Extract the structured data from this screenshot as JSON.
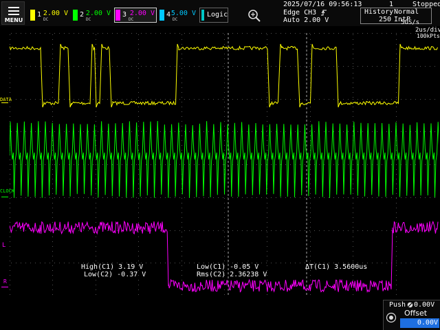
{
  "menu": {
    "label": "MENU"
  },
  "channels": [
    {
      "num": "1",
      "scale": "2.00 V",
      "color": "#ffff00",
      "coupling": "1M DC"
    },
    {
      "num": "2",
      "scale": "2.00 V",
      "color": "#00ff00",
      "coupling": "1M DC"
    },
    {
      "num": "3",
      "scale": "2.00 V",
      "color": "#ff00ff",
      "coupling": "1M DC",
      "selected": true
    },
    {
      "num": "4",
      "scale": "5.00 V",
      "color": "#00c8ff",
      "coupling": "1M DC"
    }
  ],
  "logic": {
    "label": "Logic"
  },
  "status": {
    "datetime": "2025/07/16 09:56:13",
    "trigger_line1": "Edge CH3",
    "trigger_line2": "Auto 2.00 V",
    "history_label": "History",
    "history_index": "1",
    "history_count": "250",
    "state": "Stopped",
    "mode": "Normal",
    "interp": "IntP",
    "sample_rate": "5GS/s",
    "timebase": "2us/div",
    "points": "100kPts"
  },
  "labels": {
    "data": "DATA",
    "clock": "CLOCK",
    "ch3_marker": "L",
    "ch4_marker": "R"
  },
  "measurements": {
    "high_c1": "High(C1)  3.19 V",
    "low_c2": "Low(C2) -0.37 V",
    "low_c1": "Low(C1) -0.05 V",
    "rms_c2": "Rms(C2)  2.36238 V",
    "dt_c1": "ΔT(C1)  3.5600us"
  },
  "offset_panel": {
    "push_label": "Push",
    "push_value": "0.00V",
    "title": "Offset",
    "value": "0.00V"
  }
}
